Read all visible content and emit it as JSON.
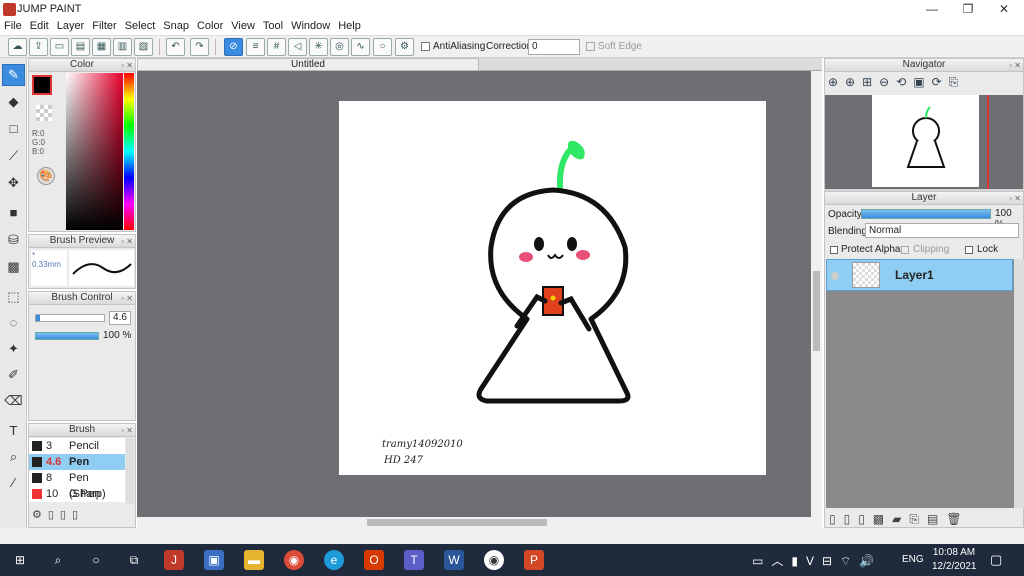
{
  "window": {
    "title": "JUMP PAINT",
    "min": "—",
    "restore": "❐",
    "close": "✕"
  },
  "menu": [
    "File",
    "Edit",
    "Layer",
    "Filter",
    "Select",
    "Snap",
    "Color",
    "View",
    "Tool",
    "Window",
    "Help"
  ],
  "toolbar": {
    "antialiasing_label": "AntiAliasing",
    "correction_label": "Correction",
    "correction_value": "0",
    "soft_edge_label": "Soft Edge"
  },
  "document": {
    "tab_title": "Untitled",
    "signature_line1": "tramy14092010",
    "signature_line2": "HD 247"
  },
  "color_panel": {
    "title": "Color",
    "r": "R:0",
    "g": "G:0",
    "b": "B:0"
  },
  "brush_preview": {
    "title": "Brush Preview",
    "size": "* 0.33mm"
  },
  "brush_control": {
    "title": "Brush Control",
    "size_value": "4.6",
    "opacity_value": "100 %"
  },
  "brush_panel": {
    "title": "Brush",
    "items": [
      {
        "size": "3",
        "name": "Pencil"
      },
      {
        "size": "4.6",
        "name": "Pen"
      },
      {
        "size": "8",
        "name": "Pen (Sharp)"
      },
      {
        "size": "10",
        "name": "G Pen"
      }
    ]
  },
  "navigator": {
    "title": "Navigator"
  },
  "layer_panel": {
    "title": "Layer",
    "opacity_label": "Opacity",
    "opacity_value": "100 %",
    "blending_label": "Blending",
    "blending_value": "Normal",
    "protect_alpha": "Protect Alpha",
    "clipping": "Clipping",
    "lock": "Lock",
    "layer_name": "Layer1"
  },
  "taskbar": {
    "time": "10:08 AM",
    "date": "12/2/2021",
    "lang": "ENG"
  },
  "colors": {
    "accent": "#3b8be0",
    "sprout": "#2ee866",
    "cheek": "#e8507a",
    "phone": "#e0401c"
  }
}
